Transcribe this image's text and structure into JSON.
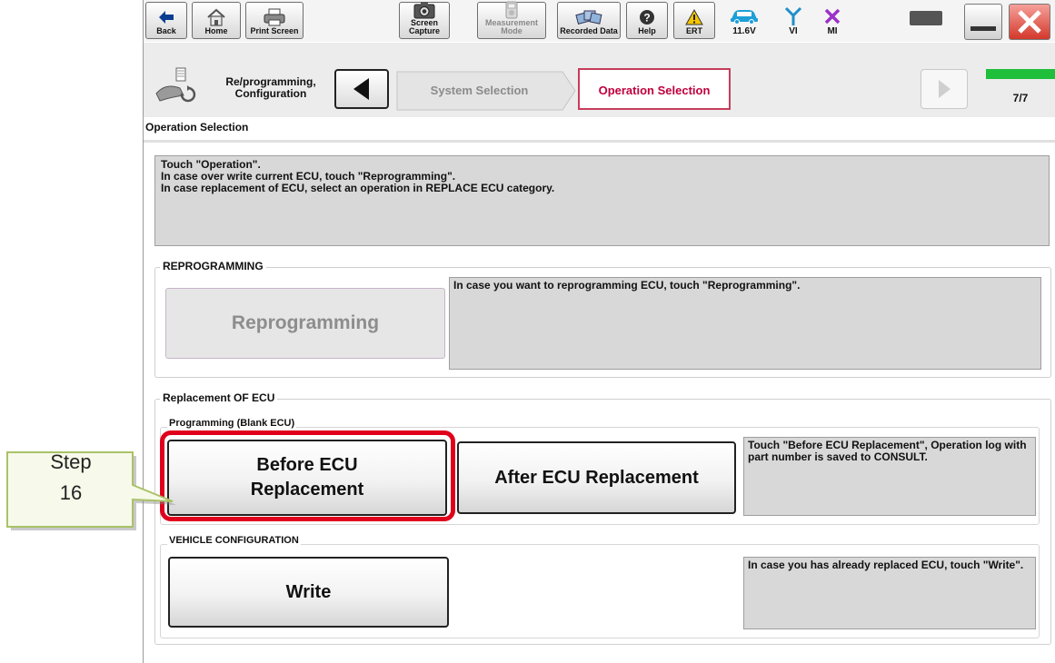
{
  "toolbar": {
    "back_label": "Back",
    "home_label": "Home",
    "print_label": "Print Screen",
    "capture_label": "Screen Capture",
    "measurement_label": "Measurement Mode",
    "recorded_label": "Recorded Data",
    "help_label": "Help",
    "ert_label": "ERT",
    "voltage": "11.6V",
    "vi_label": "VI",
    "mi_label": "MI"
  },
  "nav": {
    "mode_label": "Re/programming, Configuration",
    "crumbs": [
      "System Selection",
      "Operation Selection"
    ],
    "progress_text": "7/7",
    "progress_fraction": 1.0
  },
  "page_title": "Operation Selection",
  "instructions": [
    "Touch \"Operation\".",
    "In case over write current ECU, touch \"Reprogramming\".",
    "In case replacement of ECU, select an operation in REPLACE ECU category."
  ],
  "reprogramming": {
    "title": "REPROGRAMMING",
    "button_label": "Reprogramming",
    "description": "In case you want to reprogramming ECU, touch \"Reprogramming\"."
  },
  "replacement": {
    "title": "Replacement OF ECU",
    "programming_subtitle": "Programming (Blank ECU)",
    "before_label_line1": "Before ECU",
    "before_label_line2": "Replacement",
    "after_label": "After ECU Replacement",
    "description": "Touch \"Before ECU Replacement\", Operation log with part number is saved to CONSULT."
  },
  "vehicle_config": {
    "title": "VEHICLE CONFIGURATION",
    "write_label": "Write",
    "description": "In case you has already replaced ECU, touch \"Write\"."
  },
  "callout": {
    "line1": "Step",
    "line2": "16"
  },
  "colors": {
    "highlight_red": "#e0001b",
    "active_crumb_text": "#c0003c",
    "progress_green": "#1fbf3c",
    "callout_fill": "#f7f9ea",
    "callout_border": "#a9c267",
    "panel_gray": "#d8d8d8"
  }
}
